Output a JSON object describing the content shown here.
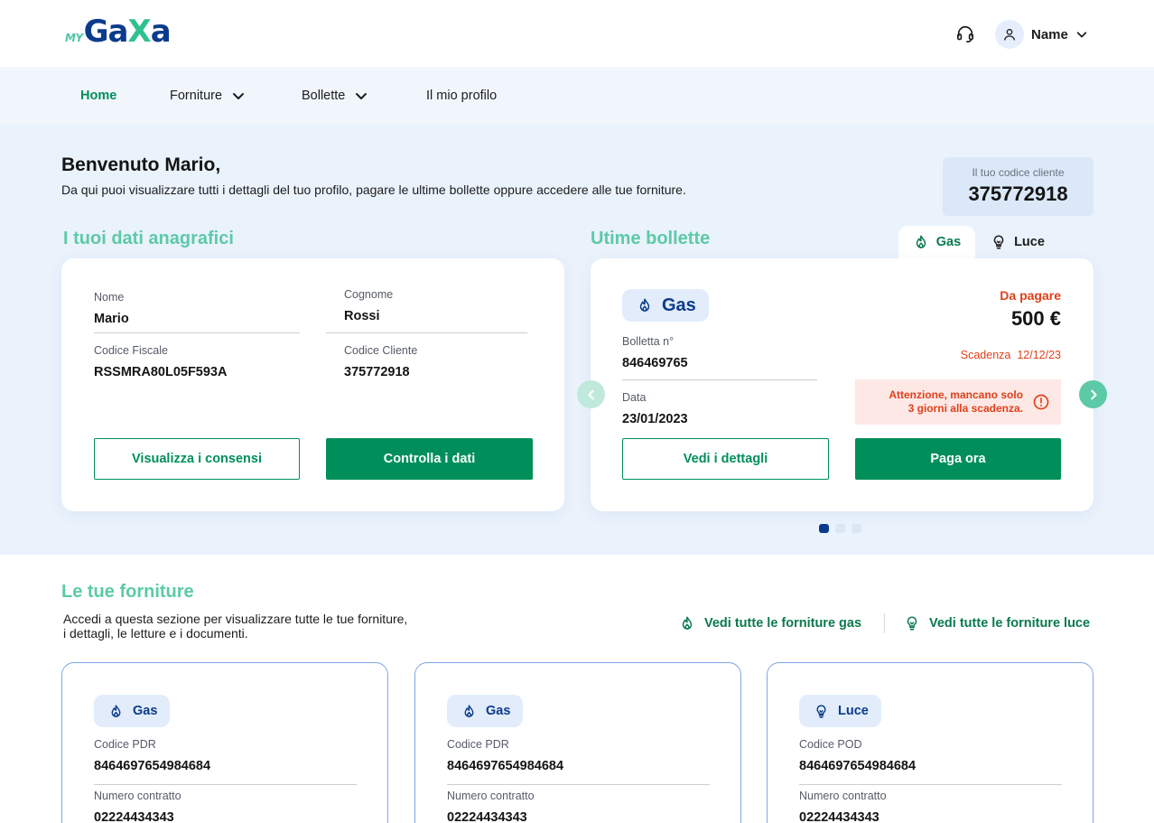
{
  "header": {
    "logo_my": "MY",
    "logo_main_a": "Ga",
    "logo_main_x": "X",
    "logo_main_b": "a",
    "user_name": "Name"
  },
  "nav": {
    "items": [
      {
        "label": "Home",
        "active": true
      },
      {
        "label": "Forniture",
        "dropdown": true
      },
      {
        "label": "Bollette",
        "dropdown": true
      },
      {
        "label": "Il mio profilo"
      }
    ]
  },
  "welcome": {
    "title": "Benvenuto Mario,",
    "subtitle": "Da qui puoi visualizzare tutti i dettagli del tuo profilo, pagare le ultime bollette oppure accedere alle tue forniture.",
    "client_code_label": "Il tuo codice cliente",
    "client_code_value": "375772918"
  },
  "anagrafica": {
    "title": "I tuoi dati anagrafici",
    "nome_label": "Nome",
    "nome_value": "Mario",
    "cognome_label": "Cognome",
    "cognome_value": "Rossi",
    "cf_label": "Codice Fiscale",
    "cf_value": "RSSMRA80L05F593A",
    "cc_label": "Codice Cliente",
    "cc_value": "375772918",
    "btn_consensi": "Visualizza i consensi",
    "btn_controlla": "Controlla i dati"
  },
  "bollette": {
    "title": "Utime bollette",
    "tab_gas": "Gas",
    "tab_luce": "Luce",
    "type_badge": "Gas",
    "status": "Da pagare",
    "amount": "500 €",
    "number_label": "Bolletta n°",
    "number_value": "846469765",
    "date_label": "Data",
    "date_value": "23/01/2023",
    "due_label": "Scadenza",
    "due_value": "12/12/23",
    "alert_line1": "Attenzione, mancano solo",
    "alert_line2": "3 giorni alla scadenza.",
    "btn_dettagli": "Vedi i dettagli",
    "btn_paga": "Paga ora",
    "carousel_active": 1,
    "carousel_total": 3
  },
  "forniture": {
    "title": "Le tue forniture",
    "subtitle_line1": "Accedi a questa sezione per visualizzare tutte le tue forniture,",
    "subtitle_line2": "i dettagli, le letture e i documenti.",
    "link_gas": "Vedi tutte le forniture gas",
    "link_luce": "Vedi tutte le forniture luce",
    "cards": [
      {
        "type": "Gas",
        "code_label": "Codice PDR",
        "code_value": "8464697654984684",
        "contract_label": "Numero contratto",
        "contract_value": "02224434343"
      },
      {
        "type": "Gas",
        "code_label": "Codice PDR",
        "code_value": "8464697654984684",
        "contract_label": "Numero contratto",
        "contract_value": "02224434343"
      },
      {
        "type": "Luce",
        "code_label": "Codice POD",
        "code_value": "8464697654984684",
        "contract_label": "Numero contratto",
        "contract_value": "02224434343"
      }
    ]
  },
  "colors": {
    "brand_green": "#008f5a",
    "accent_teal": "#5ccaa6",
    "brand_navy": "#0b3b8c",
    "alert_red": "#e0401a",
    "hero_bg": "#eaf2fc"
  },
  "icons": [
    "support-headset-icon",
    "user-icon",
    "chevron-down-icon",
    "flame-icon",
    "lightbulb-icon",
    "arrow-left-icon",
    "arrow-right-icon",
    "warning-icon"
  ]
}
